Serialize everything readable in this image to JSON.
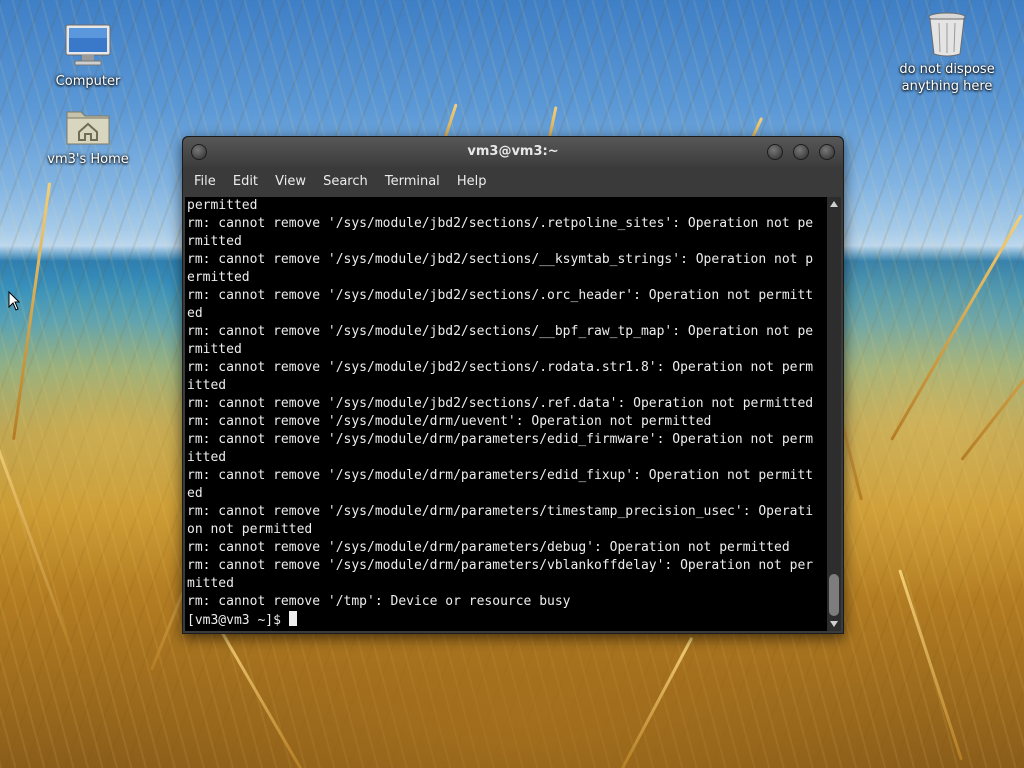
{
  "desktop": {
    "icons": [
      {
        "label": "Computer",
        "icon": "computer-icon"
      },
      {
        "label": "vm3's Home",
        "icon": "home-folder-icon"
      },
      {
        "label": "do not dispose anything here",
        "icon": "trash-icon"
      }
    ]
  },
  "terminal": {
    "title": "vm3@vm3:~",
    "menu": [
      "File",
      "Edit",
      "View",
      "Search",
      "Terminal",
      "Help"
    ],
    "lines": [
      "permitted",
      "rm: cannot remove '/sys/module/jbd2/sections/.retpoline_sites': Operation not pe",
      "rmitted",
      "rm: cannot remove '/sys/module/jbd2/sections/__ksymtab_strings': Operation not p",
      "ermitted",
      "rm: cannot remove '/sys/module/jbd2/sections/.orc_header': Operation not permitt",
      "ed",
      "rm: cannot remove '/sys/module/jbd2/sections/__bpf_raw_tp_map': Operation not pe",
      "rmitted",
      "rm: cannot remove '/sys/module/jbd2/sections/.rodata.str1.8': Operation not perm",
      "itted",
      "rm: cannot remove '/sys/module/jbd2/sections/.ref.data': Operation not permitted",
      "rm: cannot remove '/sys/module/drm/uevent': Operation not permitted",
      "rm: cannot remove '/sys/module/drm/parameters/edid_firmware': Operation not perm",
      "itted",
      "rm: cannot remove '/sys/module/drm/parameters/edid_fixup': Operation not permitt",
      "ed",
      "rm: cannot remove '/sys/module/drm/parameters/timestamp_precision_usec': Operati",
      "on not permitted",
      "rm: cannot remove '/sys/module/drm/parameters/debug': Operation not permitted",
      "rm: cannot remove '/sys/module/drm/parameters/vblankoffdelay': Operation not per",
      "mitted",
      "rm: cannot remove '/tmp': Device or resource busy"
    ],
    "prompt": "[vm3@vm3 ~]$ "
  },
  "colors": {
    "terminal_bg": "#000000",
    "terminal_fg": "#ededed",
    "titlebar": "#4a4a4a"
  }
}
